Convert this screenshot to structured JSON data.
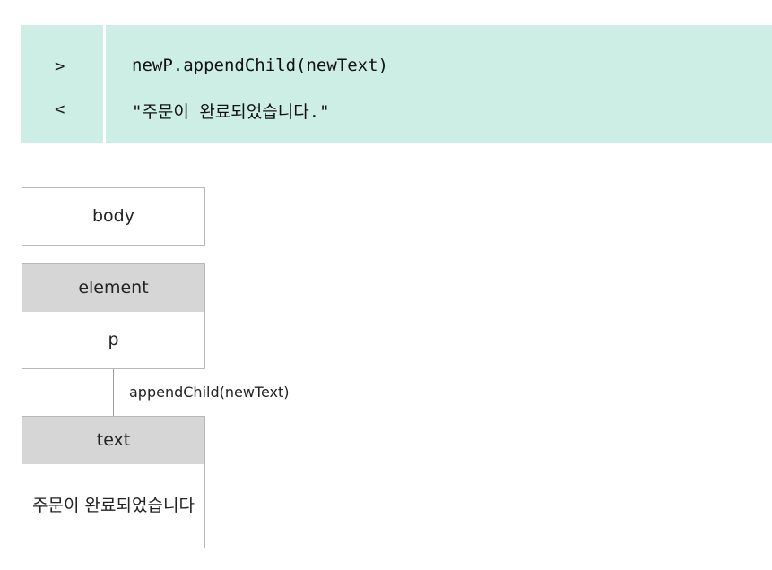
{
  "console": {
    "input_prompt": ">",
    "output_prompt": "<",
    "input_code": "newP.appendChild(newText)",
    "output_value": "\"주문이 완료되었습니다.\""
  },
  "diagram": {
    "body_label": "body",
    "element_header": "element",
    "element_value": "p",
    "connector_label": "appendChild(newText)",
    "text_header": "text",
    "text_value": "주문이 완료되었습니다"
  },
  "colors": {
    "console_background": "#cdeee5",
    "header_background": "#d6d6d6",
    "border": "#b8b8b8"
  }
}
